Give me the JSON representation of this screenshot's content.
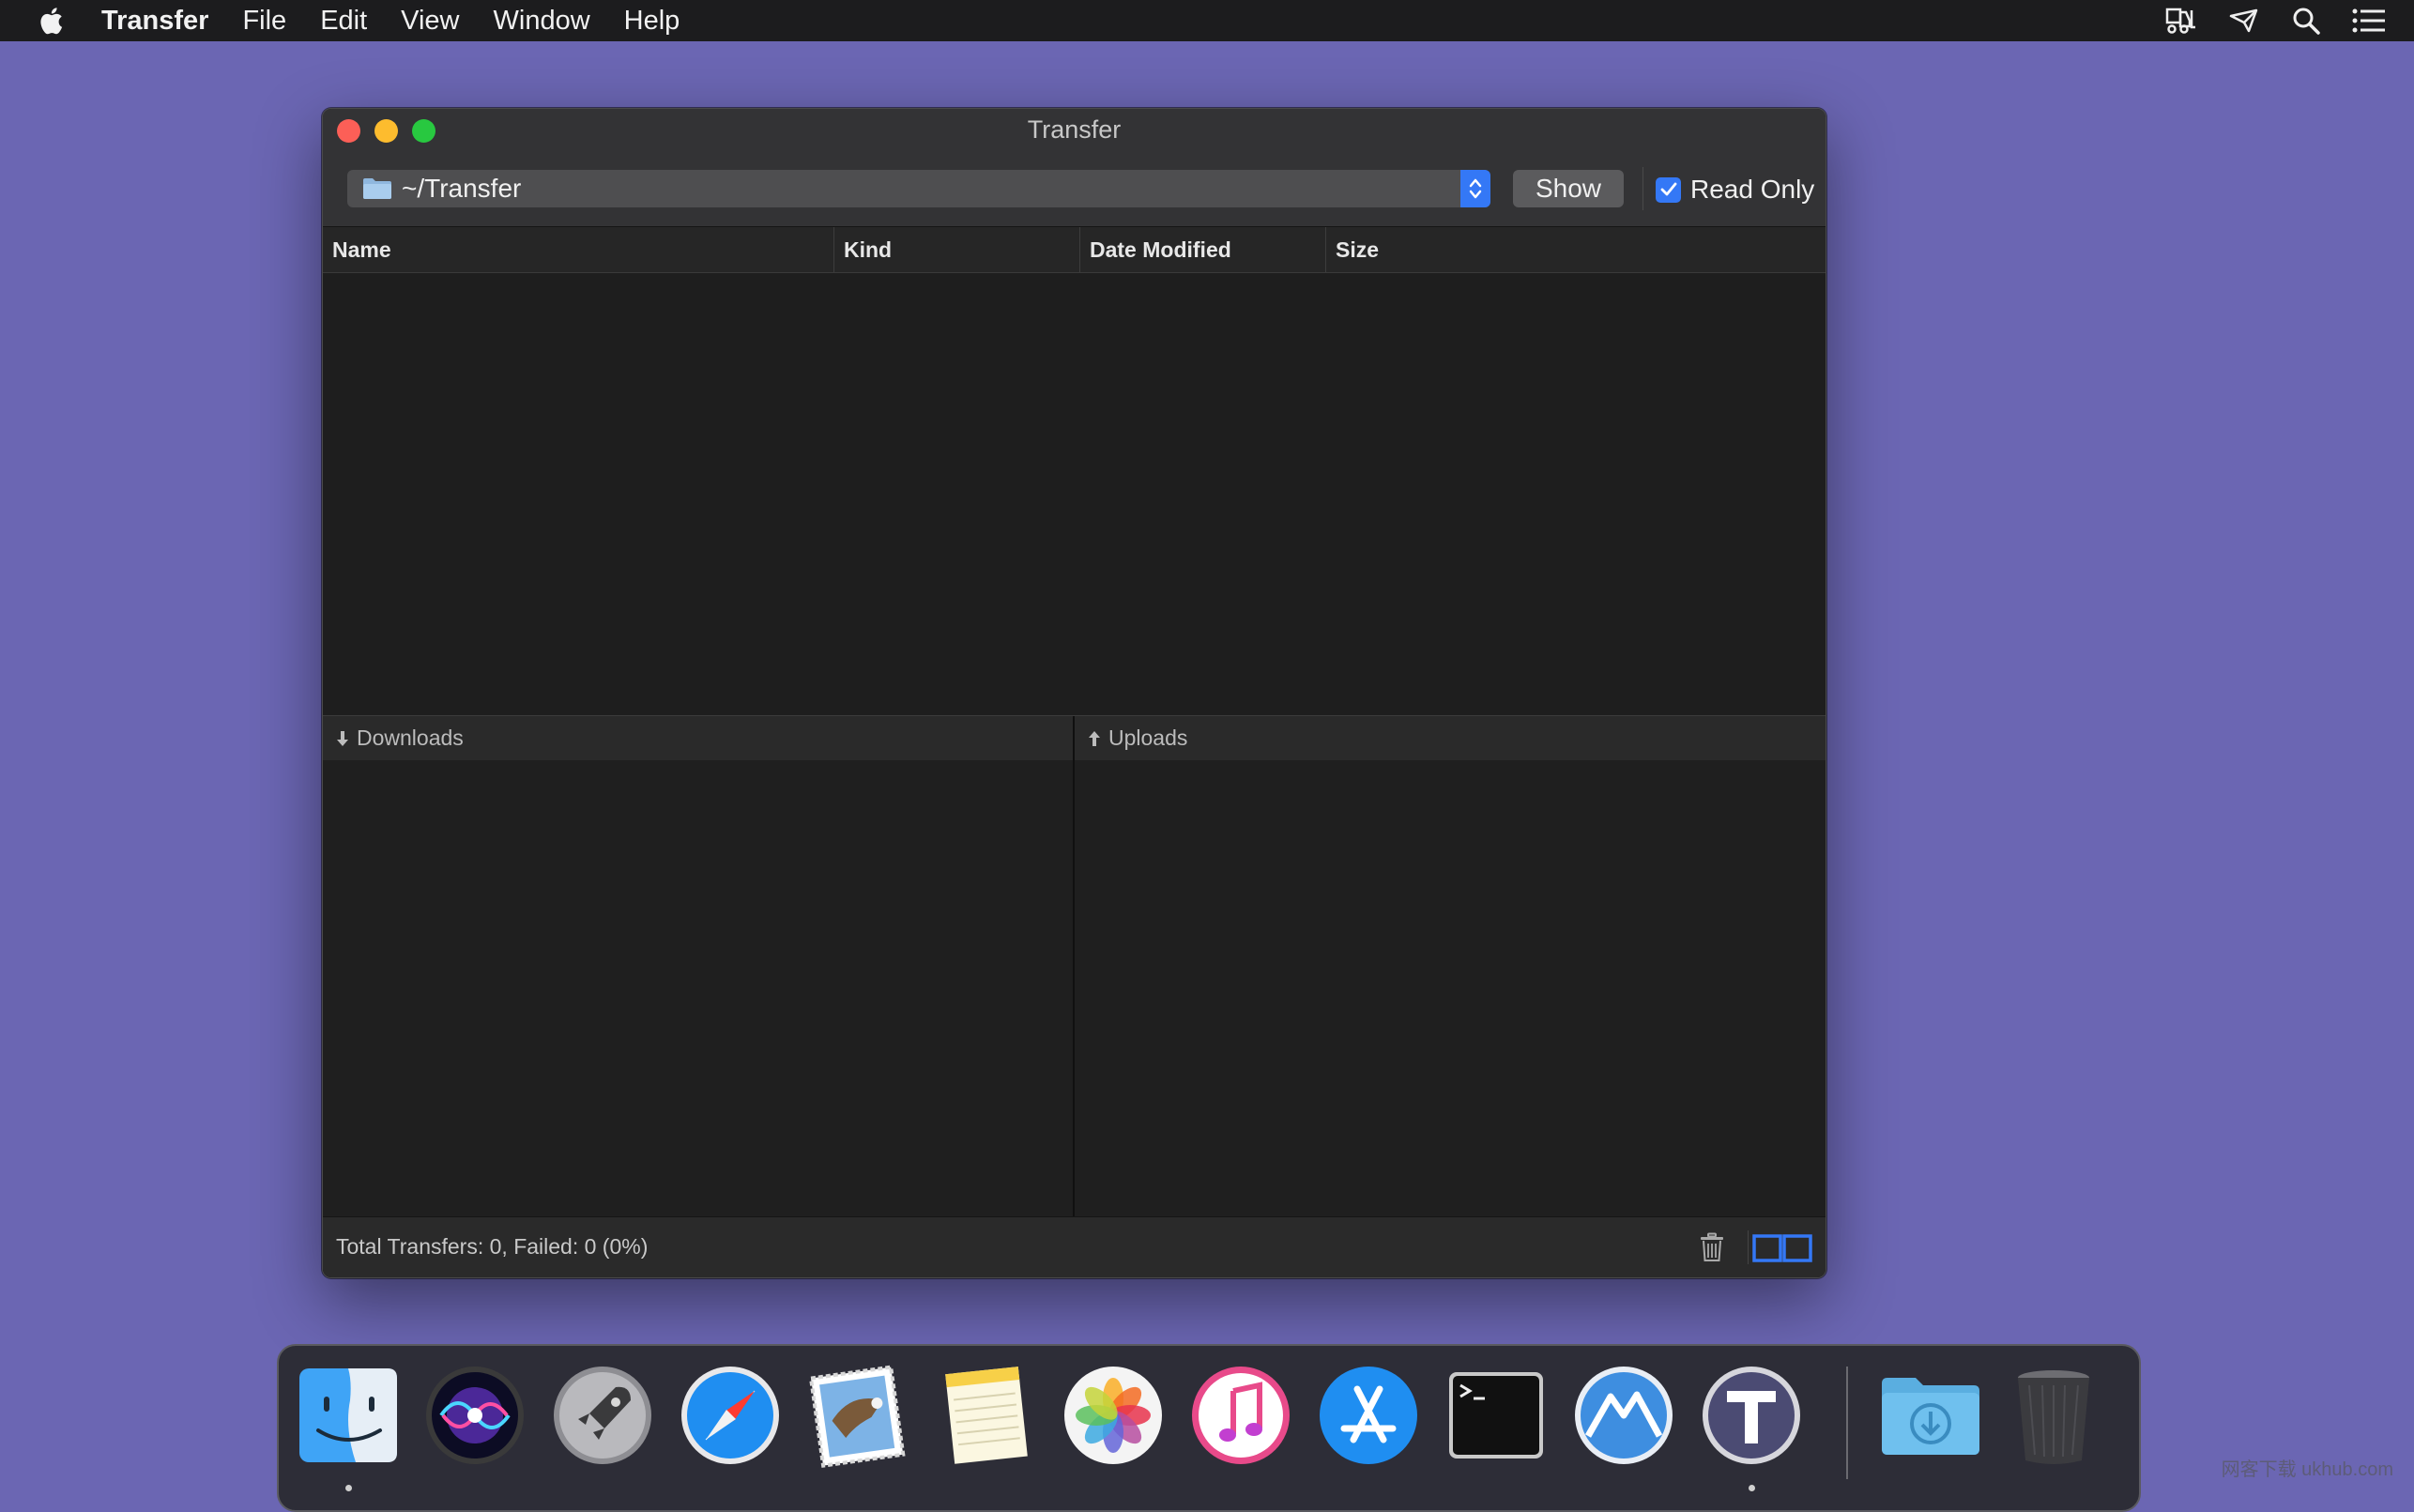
{
  "menubar": {
    "app_name": "Transfer",
    "items": [
      "File",
      "Edit",
      "View",
      "Window",
      "Help"
    ],
    "status_icons": [
      "forklift-icon",
      "transfer-status-icon",
      "spotlight-search-icon",
      "notification-center-icon"
    ]
  },
  "window": {
    "title": "Transfer",
    "path": "~/Transfer",
    "show_label": "Show",
    "read_only_label": "Read Only",
    "read_only_checked": true,
    "columns": [
      "Name",
      "Kind",
      "Date Modified",
      "Size"
    ],
    "downloads_label": "Downloads",
    "uploads_label": "Uploads",
    "status": "Total Transfers: 0, Failed: 0 (0%)"
  },
  "dock": {
    "apps": [
      "Finder",
      "Siri",
      "Launchpad",
      "Safari",
      "Mail",
      "Notes",
      "Photos",
      "iTunes",
      "App Store",
      "Terminal",
      "Mountain Duck",
      "Transfer",
      "Downloads",
      "Trash"
    ]
  },
  "colors": {
    "desktop": "#6b66b3",
    "accent": "#3478f6",
    "window_bg": "#1f1f1f",
    "close": "#fc5f57",
    "minimize": "#fdbc2e",
    "zoom": "#28c840"
  },
  "watermark": "网客下载 ukhub.com"
}
